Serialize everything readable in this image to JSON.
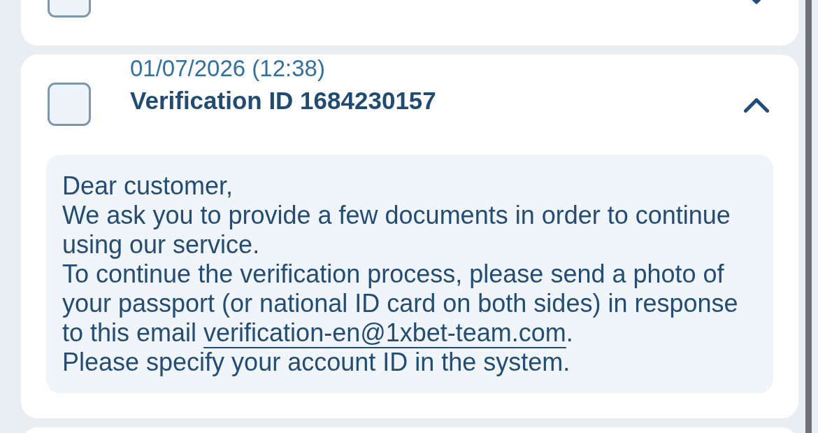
{
  "messages": [
    {
      "checked": false,
      "expanded": false
    },
    {
      "date": "01/07/2026 (12:38)",
      "title": "Verification ID 1684230157",
      "checked": false,
      "expanded": true,
      "body": [
        {
          "text": "Dear customer,"
        },
        {
          "text": "We ask you to provide a few documents in order to continue using our service."
        },
        {
          "text": "To continue the verification process, please send a photo of your passport (or national ID card on both sides) in response to this email ",
          "link": "verification-en@1xbet-team.com",
          "text_after": "."
        },
        {
          "text": "Please specify your account ID in the system."
        }
      ]
    }
  ]
}
